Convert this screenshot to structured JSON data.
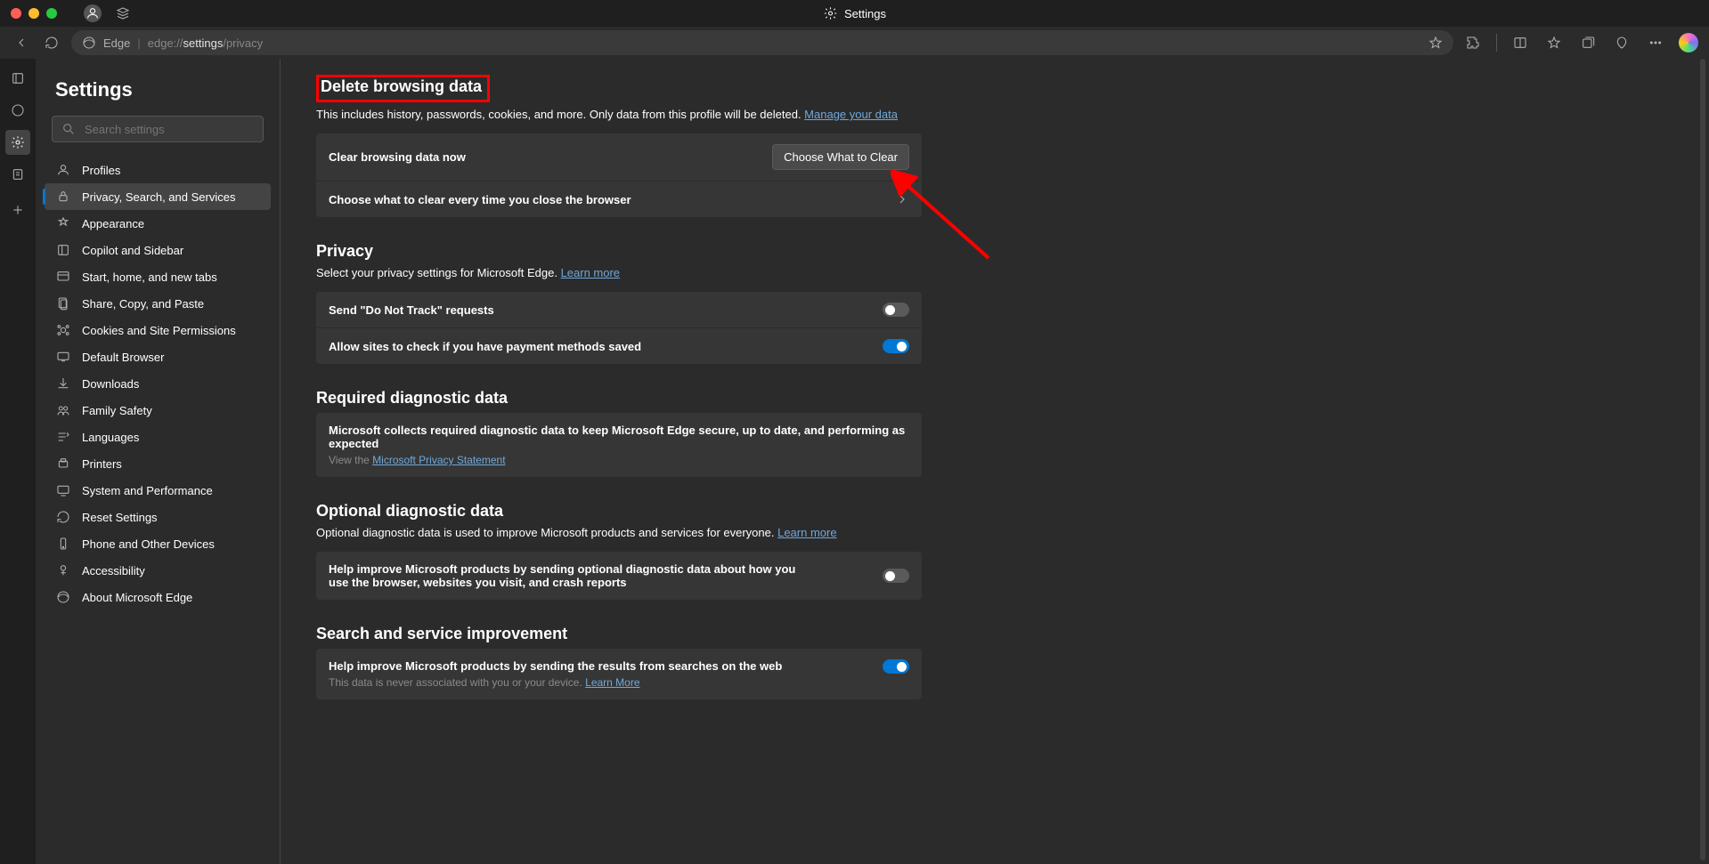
{
  "window": {
    "title": "Settings"
  },
  "url": {
    "browser_name": "Edge",
    "scheme": "edge://",
    "path_bold": "settings",
    "path_rest": "/privacy"
  },
  "sidebar": {
    "heading": "Settings",
    "search_placeholder": "Search settings",
    "items": [
      {
        "label": "Profiles"
      },
      {
        "label": "Privacy, Search, and Services"
      },
      {
        "label": "Appearance"
      },
      {
        "label": "Copilot and Sidebar"
      },
      {
        "label": "Start, home, and new tabs"
      },
      {
        "label": "Share, Copy, and Paste"
      },
      {
        "label": "Cookies and Site Permissions"
      },
      {
        "label": "Default Browser"
      },
      {
        "label": "Downloads"
      },
      {
        "label": "Family Safety"
      },
      {
        "label": "Languages"
      },
      {
        "label": "Printers"
      },
      {
        "label": "System and Performance"
      },
      {
        "label": "Reset Settings"
      },
      {
        "label": "Phone and Other Devices"
      },
      {
        "label": "Accessibility"
      },
      {
        "label": "About Microsoft Edge"
      }
    ],
    "active_index": 1
  },
  "sections": {
    "delete_data": {
      "title": "Delete browsing data",
      "desc": "This includes history, passwords, cookies, and more. Only data from this profile will be deleted. ",
      "link": "Manage your data",
      "row1_label": "Clear browsing data now",
      "row1_button": "Choose What to Clear",
      "row2_label": "Choose what to clear every time you close the browser"
    },
    "privacy": {
      "title": "Privacy",
      "desc": "Select your privacy settings for Microsoft Edge. ",
      "link": "Learn more",
      "row1_label": "Send \"Do Not Track\" requests",
      "row1_on": false,
      "row2_label": "Allow sites to check if you have payment methods saved",
      "row2_on": true
    },
    "required_diag": {
      "title": "Required diagnostic data",
      "row_label": "Microsoft collects required diagnostic data to keep Microsoft Edge secure, up to date, and performing as expected",
      "row_sub_prefix": "View the ",
      "row_sub_link": "Microsoft Privacy Statement"
    },
    "optional_diag": {
      "title": "Optional diagnostic data",
      "desc": "Optional diagnostic data is used to improve Microsoft products and services for everyone. ",
      "link": "Learn more",
      "row_label": "Help improve Microsoft products by sending optional diagnostic data about how you use the browser, websites you visit, and crash reports",
      "row_on": false
    },
    "search_improve": {
      "title": "Search and service improvement",
      "row_label": "Help improve Microsoft products by sending the results from searches on the web",
      "row_sub_prefix": "This data is never associated with you or your device. ",
      "row_sub_link": "Learn More",
      "row_on": true
    }
  }
}
